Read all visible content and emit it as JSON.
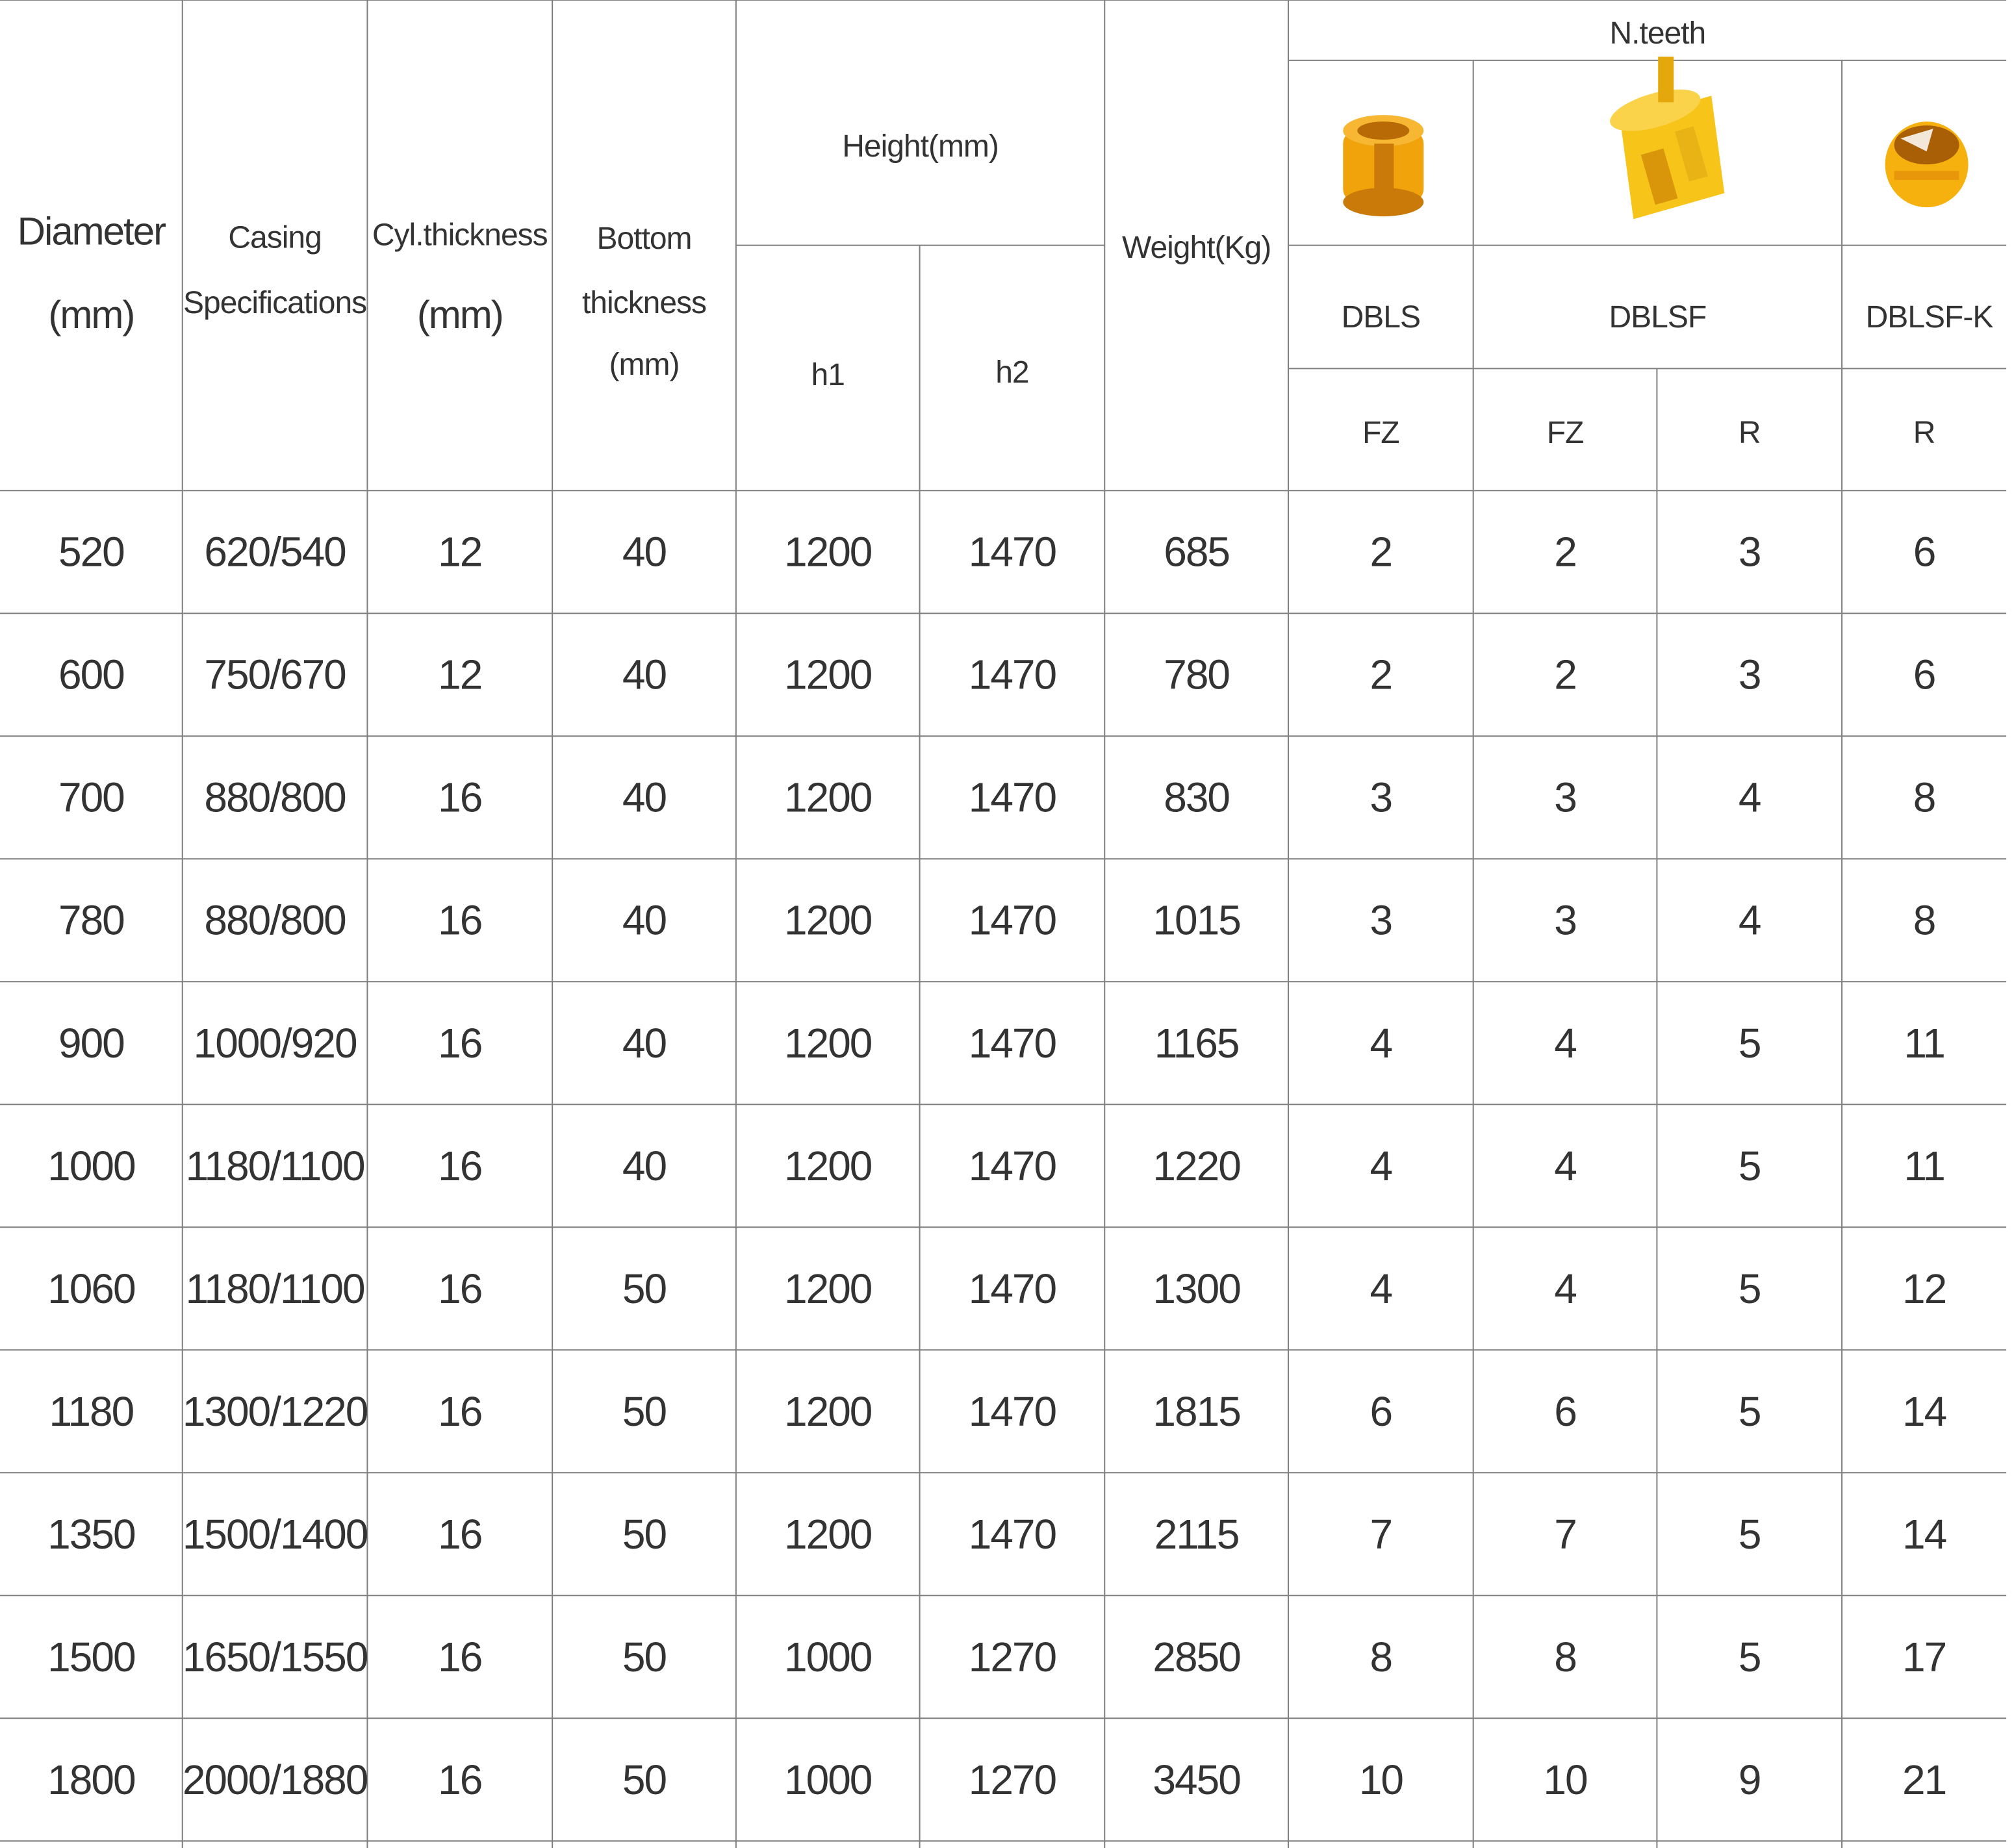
{
  "table": {
    "headers": {
      "diameter": [
        "Diameter",
        "(mm)"
      ],
      "casing": [
        "Casing",
        "Specifications"
      ],
      "cyl_thickness": [
        "Cyl.thickness",
        "(mm)"
      ],
      "bottom_thickness": [
        "Bottom",
        "thickness",
        "(mm)"
      ],
      "height": "Height(mm)",
      "h1": "h1",
      "h2": "h2",
      "weight": "Weight(Kg)",
      "n_teeth": "N.teeth",
      "models": [
        "DBLS",
        "DBLSF",
        "DBLSF-K"
      ],
      "teeth_types": [
        "FZ",
        "FZ",
        "R",
        "R"
      ]
    },
    "images": [
      {
        "name": "dbls-bucket-image",
        "icon": "cylindrical-drill-bucket-icon",
        "color": "#F0A30A"
      },
      {
        "name": "dblsf-bucket-image",
        "icon": "slotted-drill-bucket-icon",
        "color": "#F7C419"
      },
      {
        "name": "dblsf-k-bucket-image",
        "icon": "open-drill-bucket-icon",
        "color": "#F6B10F"
      }
    ],
    "rows": [
      [
        "520",
        "620/540",
        "12",
        "40",
        "1200",
        "1470",
        "685",
        "2",
        "2",
        "3",
        "6"
      ],
      [
        "600",
        "750/670",
        "12",
        "40",
        "1200",
        "1470",
        "780",
        "2",
        "2",
        "3",
        "6"
      ],
      [
        "700",
        "880/800",
        "16",
        "40",
        "1200",
        "1470",
        "830",
        "3",
        "3",
        "4",
        "8"
      ],
      [
        "780",
        "880/800",
        "16",
        "40",
        "1200",
        "1470",
        "1015",
        "3",
        "3",
        "4",
        "8"
      ],
      [
        "900",
        "1000/920",
        "16",
        "40",
        "1200",
        "1470",
        "1165",
        "4",
        "4",
        "5",
        "11"
      ],
      [
        "1000",
        "1180/1100",
        "16",
        "40",
        "1200",
        "1470",
        "1220",
        "4",
        "4",
        "5",
        "11"
      ],
      [
        "1060",
        "1180/1100",
        "16",
        "50",
        "1200",
        "1470",
        "1300",
        "4",
        "4",
        "5",
        "12"
      ],
      [
        "1180",
        "1300/1220",
        "16",
        "50",
        "1200",
        "1470",
        "1815",
        "6",
        "6",
        "5",
        "14"
      ],
      [
        "1350",
        "1500/1400",
        "16",
        "50",
        "1200",
        "1470",
        "2115",
        "7",
        "7",
        "5",
        "14"
      ],
      [
        "1500",
        "1650/1550",
        "16",
        "50",
        "1000",
        "1270",
        "2850",
        "8",
        "8",
        "5",
        "17"
      ],
      [
        "1800",
        "2000/1880",
        "16",
        "50",
        "1000",
        "1270",
        "3450",
        "10",
        "10",
        "9",
        "21"
      ]
    ]
  }
}
